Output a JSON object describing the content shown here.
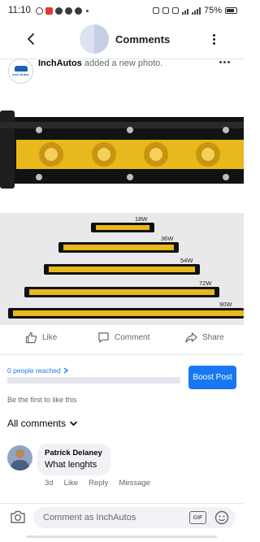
{
  "status_bar": {
    "time": "11:10",
    "battery": "75%"
  },
  "header": {
    "title": "Comments"
  },
  "post": {
    "author": "InchAutos",
    "action_text": "added a new photo.",
    "avatar_logo_text": "Inch Autos",
    "image_labels": [
      "18W",
      "36W",
      "54W",
      "72W",
      "90W"
    ],
    "bar_colors": {
      "housing": "#111111",
      "lens": "#e8b81c",
      "background": "#e9e9ec"
    }
  },
  "actions": {
    "like": "Like",
    "comment": "Comment",
    "share": "Share"
  },
  "boost": {
    "reach_text": "0 people reached",
    "reach_fraction": 0,
    "button_label": "Boost Post"
  },
  "likes_text": "Be the first to like this",
  "comments": {
    "filter_label": "All comments",
    "items": [
      {
        "author": "Patrick Delaney",
        "text": "What lenghts",
        "time": "3d",
        "like": "Like",
        "reply": "Reply",
        "message": "Message"
      }
    ]
  },
  "composer": {
    "placeholder": "Comment as InchAutos",
    "gif_label": "GIF"
  },
  "colors": {
    "accent": "#1877f2",
    "text_secondary": "#65676b",
    "bubble": "#f0f2f5"
  }
}
